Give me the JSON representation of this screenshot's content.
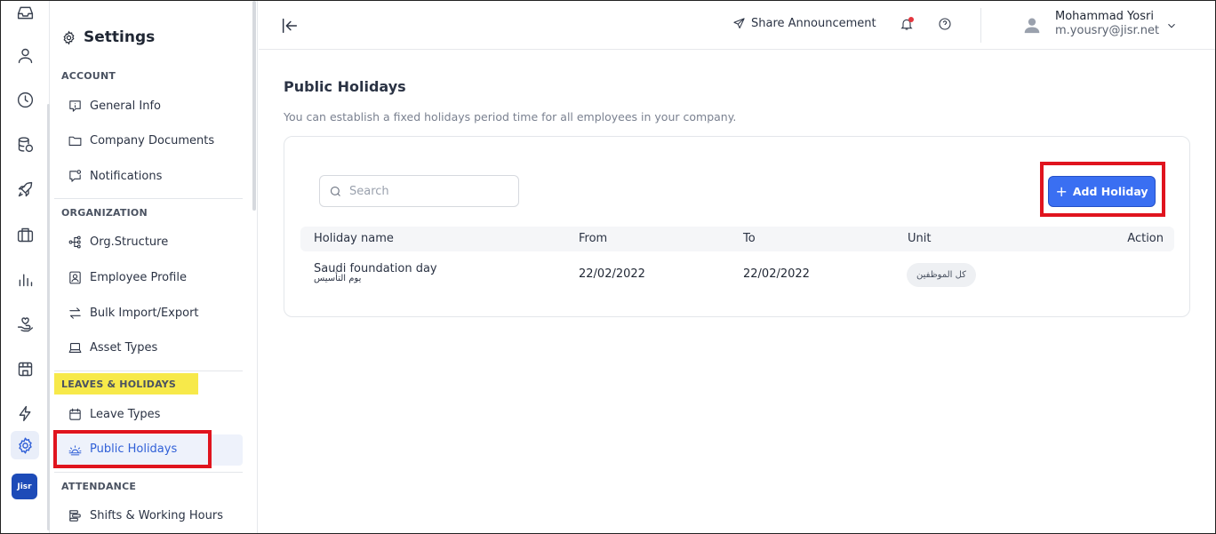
{
  "sidebar": {
    "title": "Settings",
    "sections": [
      {
        "label": "ACCOUNT",
        "items": [
          "General Info",
          "Company Documents",
          "Notifications"
        ]
      },
      {
        "label": "ORGANIZATION",
        "items": [
          "Org.Structure",
          "Employee Profile",
          "Bulk Import/Export",
          "Asset Types"
        ]
      },
      {
        "label": "LEAVES & HOLIDAYS",
        "items": [
          "Leave Types",
          "Public Holidays"
        ]
      },
      {
        "label": "ATTENDANCE",
        "items": [
          "Shifts & Working Hours"
        ]
      }
    ],
    "active_item": "Public Holidays"
  },
  "rail": {
    "logo_text": "Jisr",
    "icons": [
      "inbox-icon",
      "person-icon",
      "clock-icon",
      "payroll-icon",
      "rocket-icon",
      "briefcase-icon",
      "chart-icon",
      "hand-heart-icon",
      "store-icon",
      "bolt-icon",
      "gear-icon"
    ]
  },
  "header": {
    "share_label": "Share Announcement",
    "user_name": "Mohammad Yosri",
    "user_email": "m.yousry@jisr.net"
  },
  "main": {
    "title": "Public Holidays",
    "description": "You can establish a fixed holidays period time for all employees in your company.",
    "search_placeholder": "Search",
    "add_button_label": "Add Holiday",
    "columns": [
      "Holiday name",
      "From",
      "To",
      "Unit",
      "Action"
    ],
    "rows": [
      {
        "name": "Saudi foundation day",
        "name_ar": "يوم التأسيس",
        "from": "22/02/2022",
        "to": "22/02/2022",
        "unit": "كل الموظفين"
      }
    ]
  },
  "colors": {
    "accent": "#3a6ff2",
    "highlight": "#f7e94a",
    "annotation_red": "#e0141e"
  }
}
